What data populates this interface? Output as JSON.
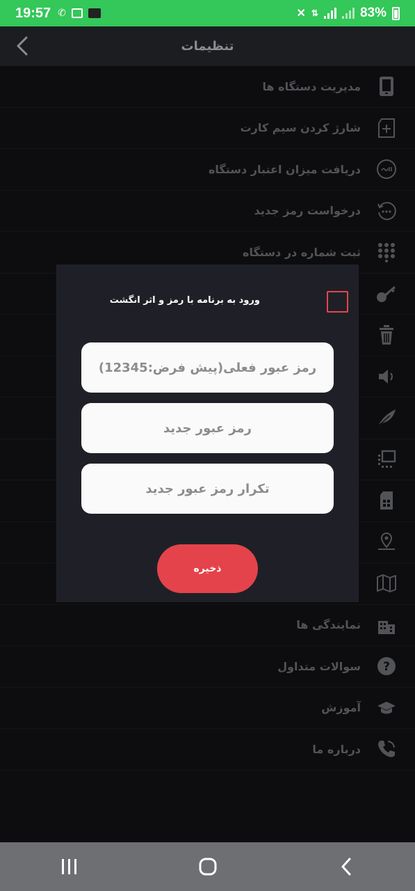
{
  "status_bar": {
    "time": "19:57",
    "battery_percent": "83%",
    "color": "#34c759"
  },
  "header": {
    "title": "تنظیمات"
  },
  "menu": [
    {
      "label": "مدیریت دستگاه ها",
      "icon": "tablet-icon"
    },
    {
      "label": "شارژ کردن سیم کارت",
      "icon": "sim-add-icon"
    },
    {
      "label": "دریافت میزان اعتبار دستگاه",
      "icon": "rial-icon"
    },
    {
      "label": "درخواست رمز جدید",
      "icon": "password-reset-icon"
    },
    {
      "label": "ثبت شماره در دستگاه",
      "icon": "dialpad-icon"
    },
    {
      "label": "",
      "icon": "key-icon"
    },
    {
      "label": "",
      "icon": "trash-icon"
    },
    {
      "label": "",
      "icon": "speaker-icon"
    },
    {
      "label": "",
      "icon": "feather-icon"
    },
    {
      "label": "",
      "icon": "devices-icon"
    },
    {
      "label": "",
      "icon": "sim-icon"
    },
    {
      "label": "",
      "icon": "location-icon"
    },
    {
      "label": "",
      "icon": "map-icon"
    },
    {
      "label": "نمایندگی ها",
      "icon": "buildings-icon"
    },
    {
      "label": "سوالات متداول",
      "icon": "help-icon"
    },
    {
      "label": "آموزش",
      "icon": "graduation-cap-icon"
    },
    {
      "label": "درباره ما",
      "icon": "phone-call-icon"
    }
  ],
  "dialog": {
    "fingerprint_label": "ورود به برنامه با رمز و اثر انگشت",
    "fingerprint_checked": false,
    "current_password_placeholder": "رمز عبور فعلی(پیش فرض:12345)",
    "new_password_placeholder": "رمز عبور جدید",
    "repeat_password_placeholder": "تکرار رمز عبور جدید",
    "save_label": "ذخیره",
    "accent_color": "#e5434b"
  },
  "nav_bar": {
    "buttons": [
      "recents-icon",
      "home-icon",
      "back-icon"
    ]
  }
}
